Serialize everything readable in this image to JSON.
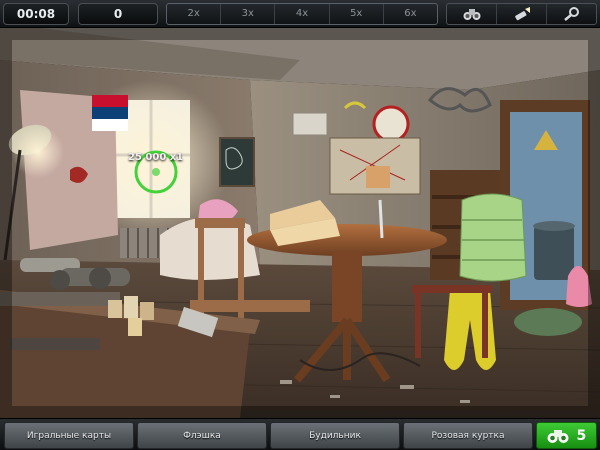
{
  "hud": {
    "timer": "00:08",
    "score": "0",
    "multipliers": [
      "2x",
      "3x",
      "4x",
      "5x",
      "6x"
    ],
    "tools": [
      {
        "icon": "binoculars-icon"
      },
      {
        "icon": "flashlight-icon"
      },
      {
        "icon": "magnifier-icon"
      }
    ]
  },
  "scene": {
    "flag_colors": [
      "#c8102e",
      "#0c4076",
      "#ffffff"
    ],
    "floating_score": "25 000 x1"
  },
  "items": [
    {
      "label": "Игральные карты"
    },
    {
      "label": "Флэшка"
    },
    {
      "label": "Будильник"
    },
    {
      "label": "Розовая куртка"
    }
  ],
  "hint": {
    "icon": "binoculars-icon",
    "count": "5"
  },
  "colors": {
    "accent_green": "#2fb626",
    "hud_dark": "#0f1214"
  }
}
